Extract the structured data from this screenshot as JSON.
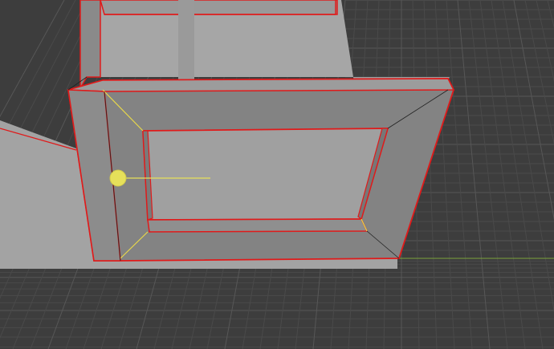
{
  "viewport": {
    "label": "",
    "background_color": "#3d3d3d",
    "grid_minor_color": "#4a4a4a",
    "grid_major_color": "#575757",
    "x_axis_color": "#7aa33a"
  },
  "scene": {
    "floor_color": "#a0a0a0",
    "wall_color": "#8a8a8a",
    "frame_face_color": "#838383",
    "frame_inner_color": "#7a7a7a",
    "frame_light_color": "#9c9c9c",
    "selection_outline_color": "#e01a1a",
    "selection_edge_color": "#e8d84a",
    "light_gizmo_color": "#e6e05a",
    "light_gizmo_label": ""
  },
  "objects": [
    {
      "name": "floor-slab",
      "selected": false
    },
    {
      "name": "wall-left",
      "selected": true
    },
    {
      "name": "door-frame",
      "selected": true
    },
    {
      "name": "pillar",
      "selected": false
    },
    {
      "name": "area-light",
      "selected": false
    }
  ]
}
